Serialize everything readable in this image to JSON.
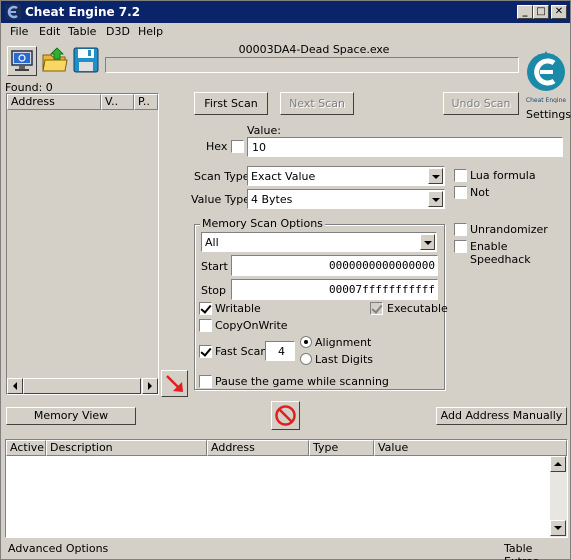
{
  "window": {
    "title": "Cheat Engine 7.2"
  },
  "menu": [
    "File",
    "Edit",
    "Table",
    "D3D",
    "Help"
  ],
  "process": {
    "name": "00003DA4-Dead Space.exe"
  },
  "found": "Found: 0",
  "results_headers": [
    "Address",
    "V..",
    "P.."
  ],
  "buttons": {
    "first_scan": "First Scan",
    "next_scan": "Next Scan",
    "undo_scan": "Undo Scan",
    "memory_view": "Memory View",
    "add_address": "Add Address Manually"
  },
  "settings_label": "Settings",
  "value": {
    "label": "Value:",
    "hex_label": "Hex",
    "current": "10"
  },
  "scan_type": {
    "label": "Scan Type",
    "selected": "Exact Value"
  },
  "value_type": {
    "label": "Value Type",
    "selected": "4 Bytes"
  },
  "options": {
    "lua_formula": "Lua formula",
    "not": "Not",
    "unrandomizer": "Unrandomizer",
    "enable_speedhack": "Enable Speedhack"
  },
  "memory_scan": {
    "title": "Memory Scan Options",
    "region": "All",
    "start_label": "Start",
    "start_value": "0000000000000000",
    "stop_label": "Stop",
    "stop_value": "00007fffffffffff",
    "writable": "Writable",
    "executable": "Executable",
    "copy_on_write": "CopyOnWrite",
    "fast_scan": "Fast Scan",
    "fast_scan_value": "4",
    "alignment": "Alignment",
    "last_digits": "Last Digits",
    "pause": "Pause the game while scanning"
  },
  "table_headers": [
    "Active",
    "Description",
    "Address",
    "Type",
    "Value"
  ],
  "status": {
    "left": "Advanced Options",
    "right": "Table Extras"
  }
}
